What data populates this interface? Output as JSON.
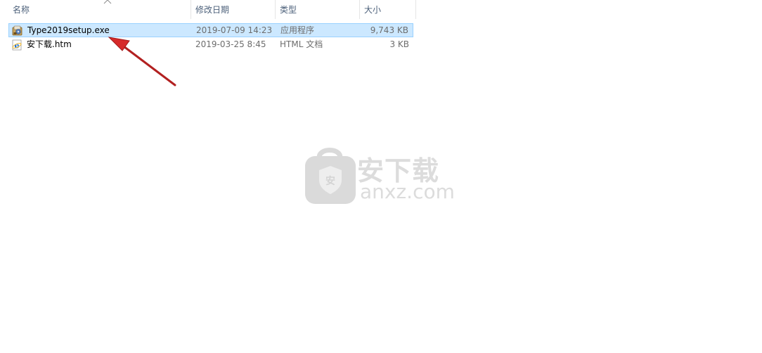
{
  "header": {
    "col_name": "名称",
    "col_date": "修改日期",
    "col_type": "类型",
    "col_size": "大小"
  },
  "files": [
    {
      "name": "Type2019setup.exe",
      "date": "2019-07-09 14:23",
      "type": "应用程序",
      "size": "9,743 KB",
      "icon": "installer-icon",
      "selected": true
    },
    {
      "name": "安下载.htm",
      "date": "2019-03-25 8:45",
      "type": "HTML 文档",
      "size": "3 KB",
      "icon": "ie-html-icon",
      "selected": false
    }
  ],
  "watermark": {
    "cn": "安下载",
    "en": "anxz.com",
    "shield_char": "安"
  },
  "colors": {
    "selection_bg": "#cce8ff",
    "selection_border": "#99d1ff",
    "header_text": "#4c607a",
    "arrow": "#d62a2a"
  }
}
